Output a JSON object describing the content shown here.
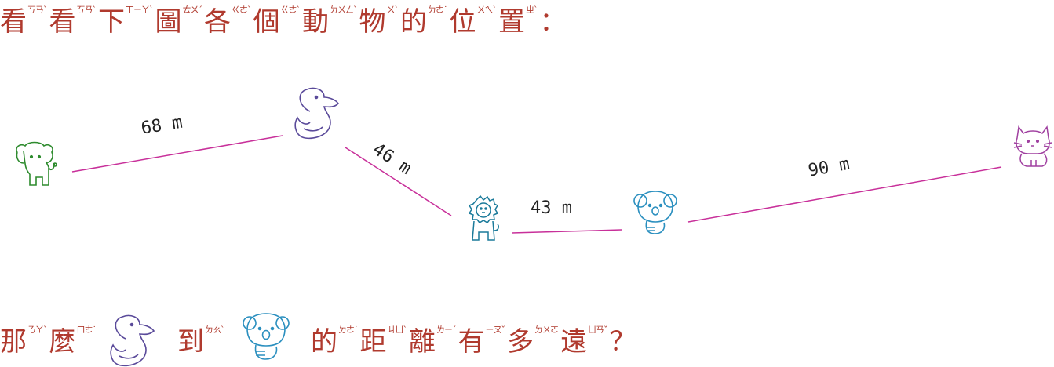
{
  "heading": {
    "chars": [
      {
        "c": "看",
        "z": "ㄎㄢˋ"
      },
      {
        "c": "看",
        "z": "ㄎㄢˋ"
      },
      {
        "c": "下",
        "z": "ㄒㄧㄚˋ"
      },
      {
        "c": "圖",
        "z": "ㄊㄨˊ"
      },
      {
        "c": "各",
        "z": "ㄍㄜˋ"
      },
      {
        "c": "個",
        "z": "ㄍㄜˋ"
      },
      {
        "c": "動",
        "z": "ㄉㄨㄥˋ"
      },
      {
        "c": "物",
        "z": "ㄨˋ"
      },
      {
        "c": "的",
        "z": "ㄉㄜ˙"
      },
      {
        "c": "位",
        "z": "ㄨㄟˋ"
      },
      {
        "c": "置",
        "z": "ㄓˋ"
      }
    ],
    "end": "："
  },
  "distances": {
    "elephant_duck": "68 m",
    "duck_lion": "46 m",
    "lion_koala": "43 m",
    "koala_cat": "90 m"
  },
  "question": {
    "part1": [
      {
        "c": "那",
        "z": "ㄋㄚˋ"
      },
      {
        "c": "麼",
        "z": "ㄇㄜ˙"
      }
    ],
    "animal1": "duck",
    "part2": [
      {
        "c": "到",
        "z": "ㄉㄠˋ"
      }
    ],
    "animal2": "koala",
    "part3": [
      {
        "c": "的",
        "z": "ㄉㄜ˙"
      },
      {
        "c": "距",
        "z": "ㄐㄩˋ"
      },
      {
        "c": "離",
        "z": "ㄌㄧˊ"
      },
      {
        "c": "有",
        "z": "ㄧㄡˇ"
      },
      {
        "c": "多",
        "z": "ㄉㄨㄛ"
      },
      {
        "c": "遠",
        "z": "ㄩㄢˇ"
      }
    ],
    "end": "？"
  },
  "colors": {
    "text": "#b03a2e",
    "route": "#c8309a",
    "elephant": "#2e8b2e",
    "duck": "#5a4a9a",
    "lion": "#1a7a9a",
    "koala": "#2a8fbf",
    "cat": "#a040a0"
  },
  "icons": [
    "elephant-icon",
    "duck-icon",
    "lion-icon",
    "koala-icon",
    "cat-icon"
  ]
}
